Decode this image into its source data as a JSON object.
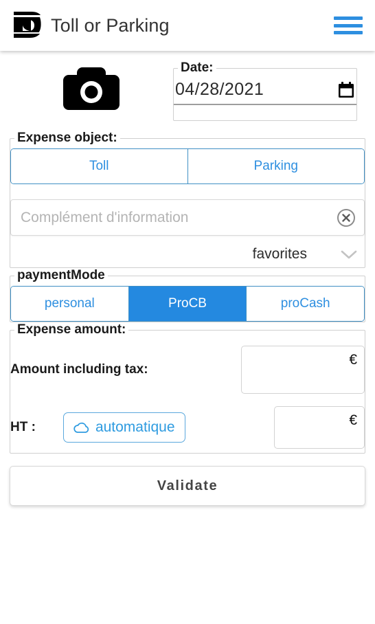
{
  "header": {
    "title": "Toll or Parking",
    "logo_alt": "app-logo",
    "menu_icon": "hamburger-menu-icon"
  },
  "capture": {
    "camera_icon": "camera-icon"
  },
  "date": {
    "legend": "Date:",
    "value": "04/28/2021",
    "picker_icon": "calendar-icon"
  },
  "expense_object": {
    "legend": "Expense object:",
    "options": [
      {
        "label": "Toll",
        "selected": false
      },
      {
        "label": "Parking",
        "selected": false
      }
    ],
    "complement": {
      "value": "",
      "placeholder": "Complément d'information",
      "clear_icon": "clear-circle-icon"
    },
    "favorites": {
      "label": "favorites",
      "chevron_icon": "chevron-down-icon"
    }
  },
  "payment_mode": {
    "legend": "paymentMode",
    "options": [
      {
        "label": "personal",
        "selected": false
      },
      {
        "label": "ProCB",
        "selected": true
      },
      {
        "label": "proCash",
        "selected": false
      }
    ]
  },
  "expense_amount": {
    "legend": "Expense amount:",
    "including_tax": {
      "label": "Amount including tax:",
      "value": "",
      "currency": "€"
    },
    "ht": {
      "label": "HT :",
      "auto_button": "automatique",
      "auto_icon": "cloud-icon",
      "value": "",
      "currency": "€"
    }
  },
  "actions": {
    "validate": "Validate"
  },
  "colors": {
    "accent_blue": "#2489E0",
    "link_blue": "#2E8FE0",
    "border_gray": "#cfcfcf",
    "text_dark": "#1a1a1a"
  }
}
